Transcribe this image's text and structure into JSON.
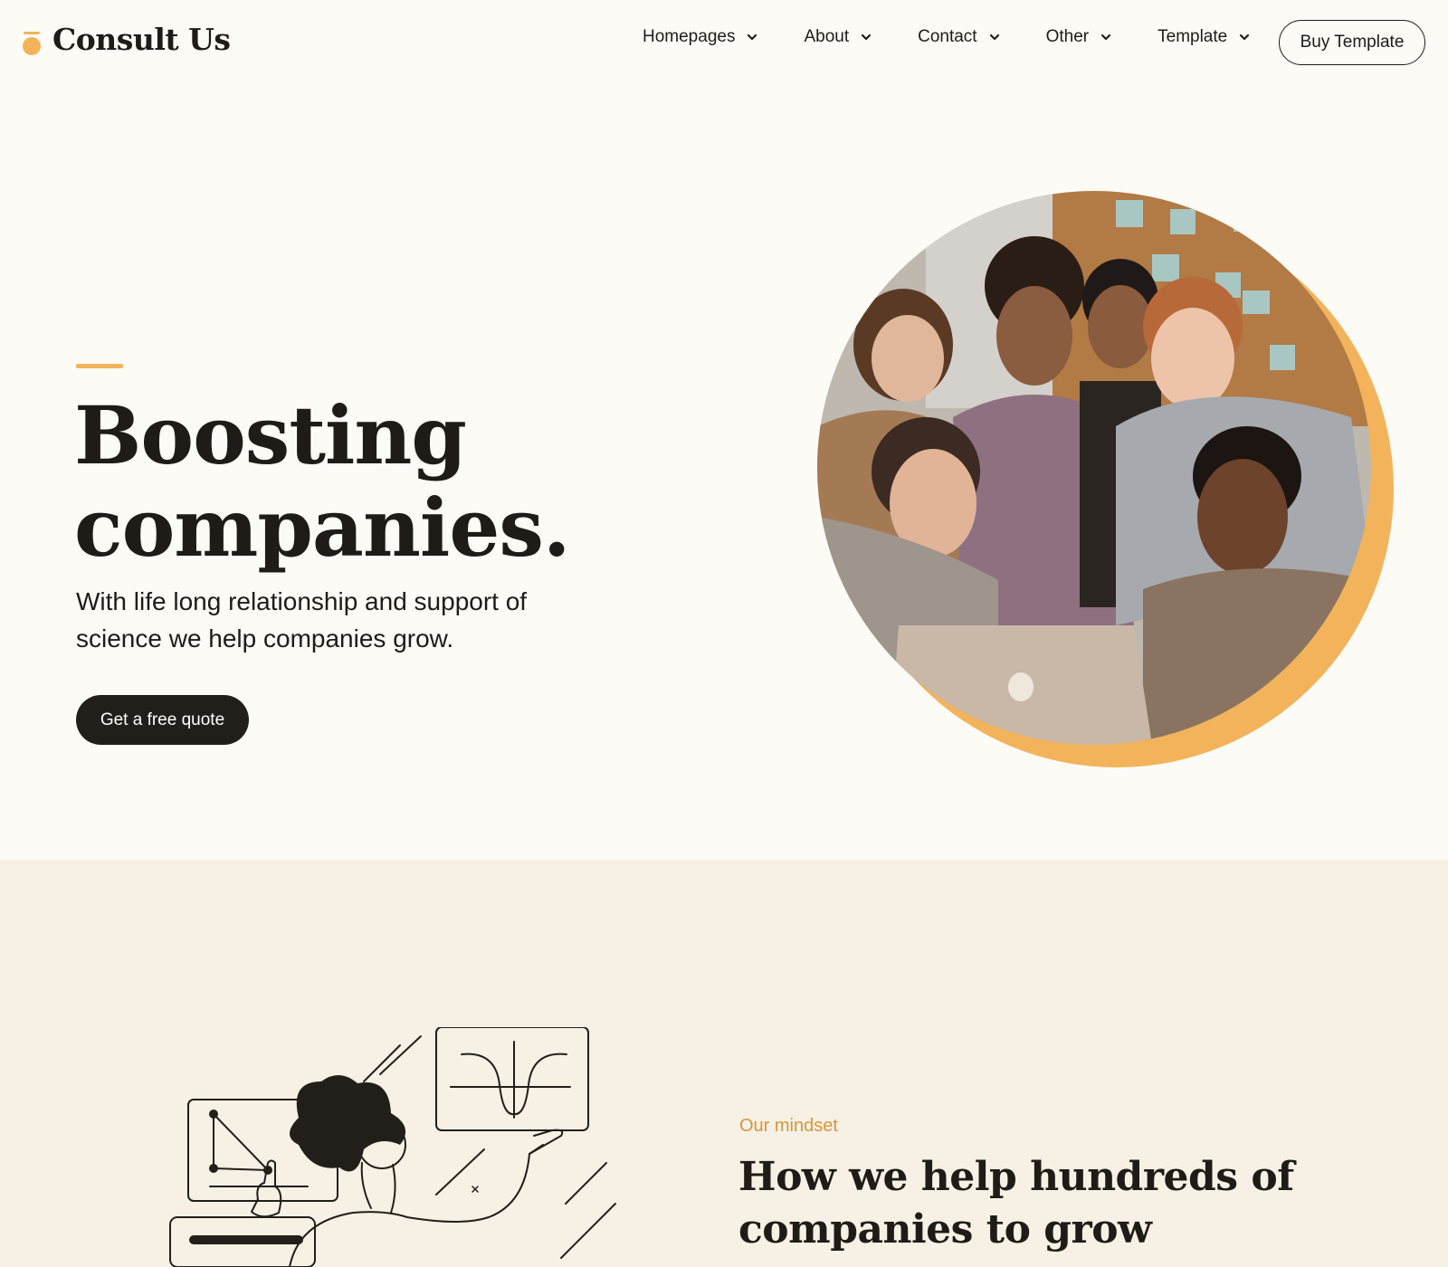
{
  "brand": {
    "name": "Consult Us",
    "accent_color": "#f2b35b",
    "dark_color": "#221e19"
  },
  "nav": {
    "items": [
      {
        "label": "Homepages",
        "icon": "chevron-down-icon"
      },
      {
        "label": "About",
        "icon": "chevron-down-icon"
      },
      {
        "label": "Contact",
        "icon": "chevron-down-icon"
      },
      {
        "label": "Other",
        "icon": "chevron-down-icon"
      },
      {
        "label": "Template",
        "icon": "chevron-down-icon"
      }
    ],
    "buy_label": "Buy Template"
  },
  "hero": {
    "title_line1": "Boosting",
    "title_line2": "companies.",
    "subtitle": "With life long relationship and support of science we help companies grow.",
    "cta_label": "Get a free quote",
    "image": "team-photo"
  },
  "mindset": {
    "eyebrow": "Our mindset",
    "title": "How we help hundreds of companies to grow",
    "illustration": "person-presenting-charts-illustration",
    "background": "#f6f1e4"
  }
}
